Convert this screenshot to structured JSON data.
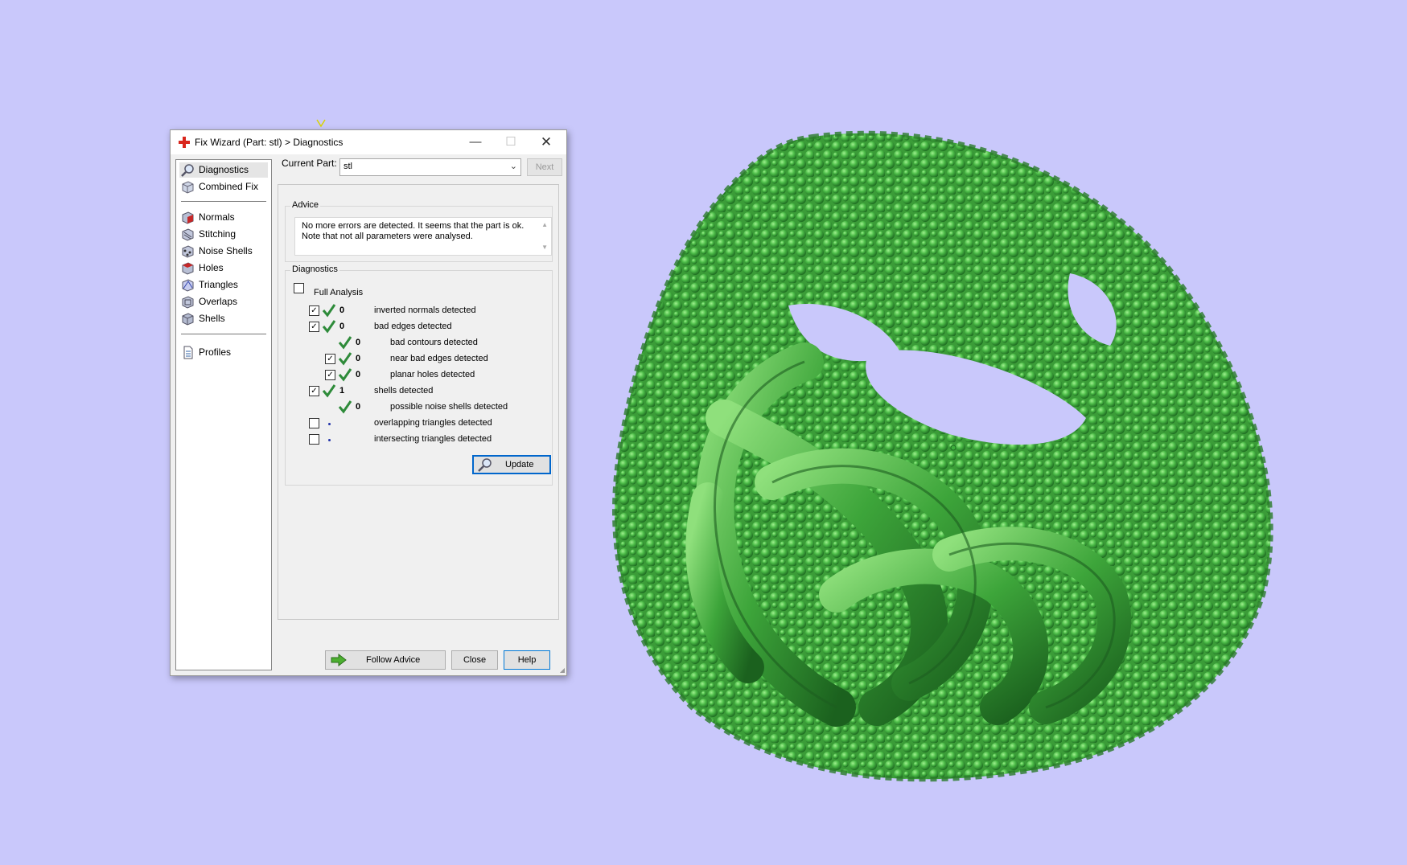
{
  "window": {
    "title": "Fix Wizard (Part: stl) > Diagnostics",
    "minimize_icon": "minimize-icon",
    "maximize_icon": "maximize-icon",
    "close_icon": "close-icon"
  },
  "sidebar": {
    "items": [
      {
        "label": "Diagnostics",
        "icon": "magnifier-icon",
        "active": true
      },
      {
        "label": "Combined Fix",
        "icon": "cube-icon"
      },
      {
        "label": "Normals",
        "icon": "cube-red-icon"
      },
      {
        "label": "Stitching",
        "icon": "cube-stitch-icon"
      },
      {
        "label": "Noise Shells",
        "icon": "cube-noise-icon"
      },
      {
        "label": "Holes",
        "icon": "cube-hole-icon"
      },
      {
        "label": "Triangles",
        "icon": "cube-triangle-icon"
      },
      {
        "label": "Overlaps",
        "icon": "cube-overlap-icon"
      },
      {
        "label": "Shells",
        "icon": "cube-shells-icon"
      },
      {
        "label": "Profiles",
        "icon": "document-icon"
      }
    ]
  },
  "current_part": {
    "label": "Current Part:",
    "value": "stl"
  },
  "next_label": "Next",
  "advice": {
    "title": "Advice",
    "text": "No more errors are detected. It seems that the part is ok. Note that not all parameters were analysed."
  },
  "diagnostics": {
    "title": "Diagnostics",
    "full_analysis": {
      "label": "Full Analysis",
      "checked": false
    },
    "rows": [
      {
        "label": "inverted normals detected",
        "value": "0",
        "checked": true,
        "has_checkbox": true
      },
      {
        "label": "bad edges detected",
        "value": "0",
        "checked": true,
        "has_checkbox": true
      },
      {
        "label": "bad contours detected",
        "value": "0",
        "has_checkbox": false
      },
      {
        "label": "near bad edges detected",
        "value": "0",
        "checked": true,
        "has_checkbox": true
      },
      {
        "label": "planar holes detected",
        "value": "0",
        "checked": true,
        "has_checkbox": true
      },
      {
        "label": "shells detected",
        "value": "1",
        "checked": true,
        "has_checkbox": true
      },
      {
        "label": "possible noise shells detected",
        "value": "0",
        "has_checkbox": false
      },
      {
        "label": "overlapping triangles detected",
        "value": "",
        "checked": false,
        "has_checkbox": true
      },
      {
        "label": "intersecting triangles detected",
        "value": "",
        "checked": false,
        "has_checkbox": true
      }
    ],
    "update_label": "Update"
  },
  "buttons": {
    "follow_advice": "Follow Advice",
    "close": "Close",
    "help": "Help"
  },
  "colors": {
    "background": "#c9c8fb",
    "model_green": "#3cae3c",
    "check_green": "#2e8b3a",
    "focus_blue": "#0066cc"
  }
}
